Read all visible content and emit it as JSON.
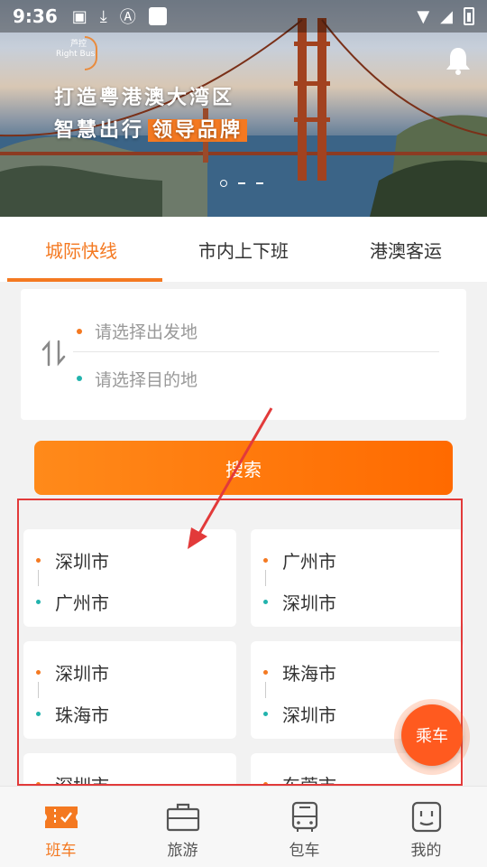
{
  "status_bar": {
    "time": "9:36"
  },
  "banner": {
    "logo_line1": "芦控",
    "logo_line2": "Right Bus",
    "slogan_line1": "打造粤港澳大湾区",
    "slogan_line2_prefix": "智慧出行",
    "slogan_line2_highlight": "领导品牌",
    "carousel_active_index": 0,
    "carousel_count": 3
  },
  "tabs": [
    {
      "label": "城际快线",
      "active": true
    },
    {
      "label": "市内上下班",
      "active": false
    },
    {
      "label": "港澳客运",
      "active": false
    }
  ],
  "search": {
    "from_placeholder": "请选择出发地",
    "to_placeholder": "请选择目的地",
    "button_label": "搜索"
  },
  "routes": [
    {
      "from": "深圳市",
      "to": "广州市"
    },
    {
      "from": "广州市",
      "to": "深圳市"
    },
    {
      "from": "深圳市",
      "to": "珠海市"
    },
    {
      "from": "珠海市",
      "to": "深圳市"
    },
    {
      "from": "深圳市",
      "to": ""
    },
    {
      "from": "东莞市",
      "to": ""
    }
  ],
  "fab": {
    "label": "乘车"
  },
  "bottom_nav": [
    {
      "label": "班车",
      "icon": "ticket-icon",
      "active": true
    },
    {
      "label": "旅游",
      "icon": "briefcase-icon",
      "active": false
    },
    {
      "label": "包车",
      "icon": "bus-icon",
      "active": false
    },
    {
      "label": "我的",
      "icon": "face-icon",
      "active": false
    }
  ],
  "colors": {
    "accent": "#f47921",
    "teal": "#22b3ad",
    "annotation_red": "#e23a3a"
  }
}
